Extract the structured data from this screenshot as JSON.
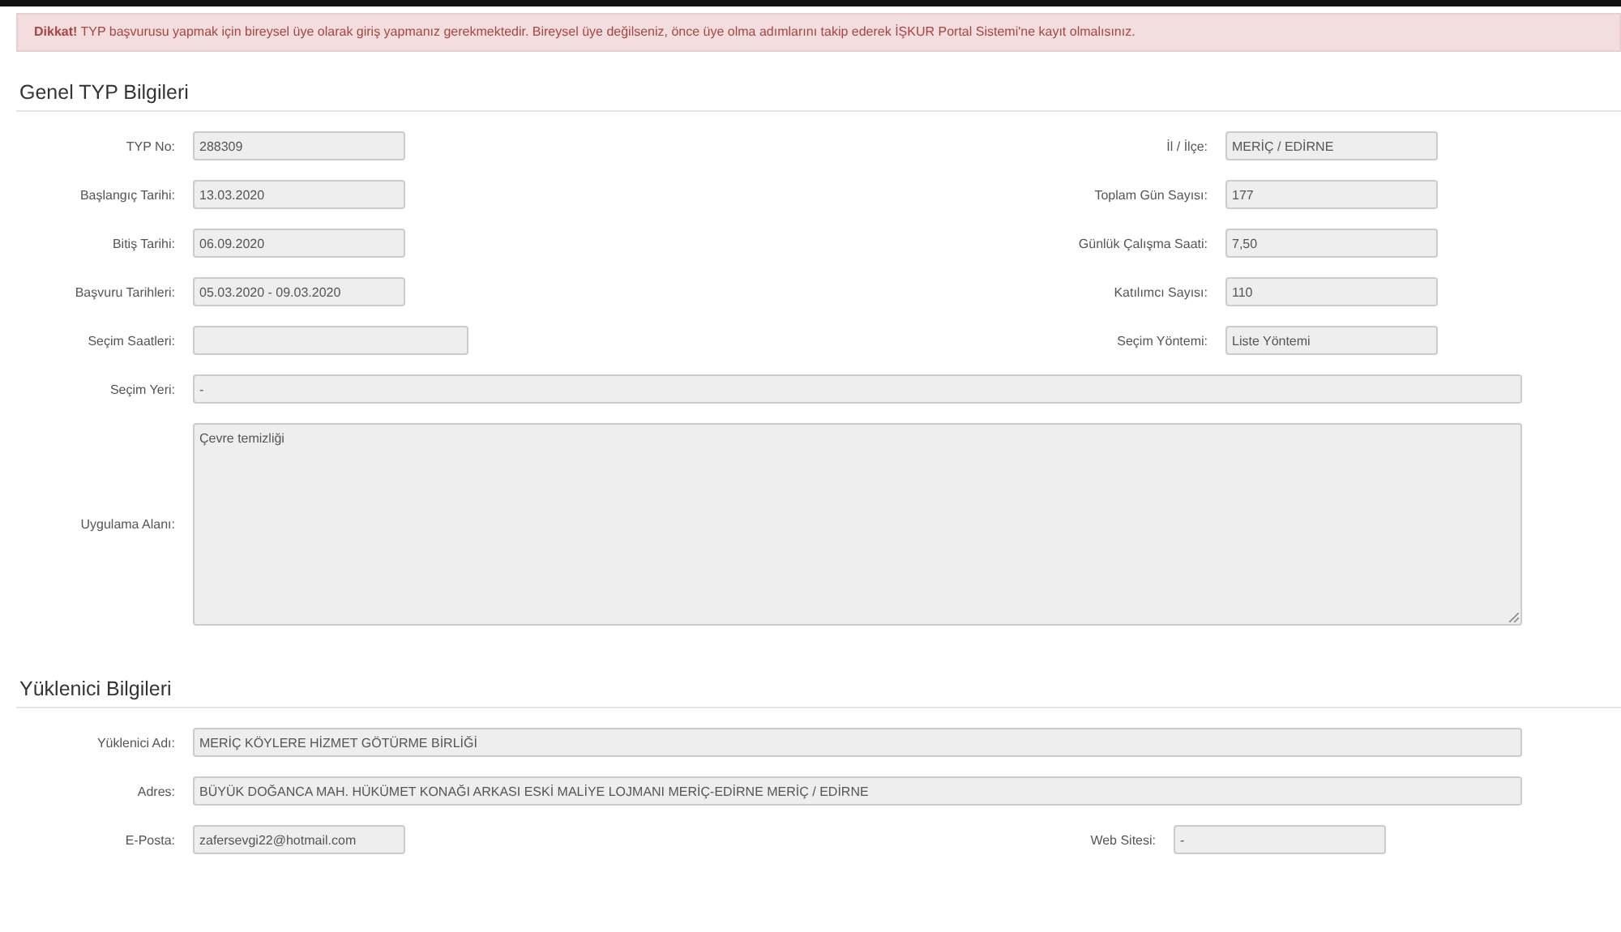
{
  "alert": {
    "text": "**Dikkat!** TYP başvurusu yapmak için bireysel üye olarak giriş yapmanız gerekmektedir. Bireysel üye değilseniz, önce üye olma adımlarını takip ederek İŞKUR Portal Sistemi'ne kayıt olmalısınız."
  },
  "sections": [
    {
      "title": "Genel TYP Bilgileri",
      "rows": [
        {
          "kind": "pair",
          "fields": [
            {
              "label": "TYP No:",
              "value": "288309",
              "kind": "short"
            },
            {
              "label": "İl / İlçe:",
              "value": "MERİÇ / EDİRNE",
              "kind": "short"
            }
          ]
        },
        {
          "kind": "pair",
          "fields": [
            {
              "label": "Başlangıç Tarihi:",
              "value": "13.03.2020",
              "kind": "short"
            },
            {
              "label": "Toplam Gün Sayısı:",
              "value": "177",
              "kind": "short"
            }
          ]
        },
        {
          "kind": "pair",
          "fields": [
            {
              "label": "Bitiş Tarihi:",
              "value": "06.09.2020",
              "kind": "short"
            },
            {
              "label": "Günlük Çalışma Saati:",
              "value": "7,50",
              "kind": "short"
            }
          ]
        },
        {
          "kind": "pair",
          "fields": [
            {
              "label": "Başvuru Tarihleri:",
              "value": "05.03.2020 - 09.03.2020",
              "kind": "short"
            },
            {
              "label": "Katılımcı Sayısı:",
              "value": "110",
              "kind": "short"
            }
          ]
        },
        {
          "kind": "pair",
          "fields": [
            {
              "label": "Seçim Saatleri:",
              "kind": "medium"
            },
            {
              "label": "Seçim Yöntemi:",
              "value": "Liste Yöntemi",
              "kind": "short"
            }
          ]
        },
        {
          "kind": "single",
          "fields": [
            {
              "label": "Seçim Yeri:",
              "value": "-",
              "kind": "full"
            }
          ]
        },
        {
          "kind": "textarea",
          "fields": [
            {
              "label": "Uygulama Alanı:",
              "value": "Çevre temizliği",
              "kind": "full"
            }
          ]
        }
      ]
    },
    {
      "title": "Yüklenici Bilgileri",
      "rows": [
        {
          "kind": "single",
          "fields": [
            {
              "label": "Yüklenici Adı:",
              "value": "MERİÇ KÖYLERE HİZMET GÖTÜRME BİRLİĞİ",
              "kind": "full"
            }
          ]
        },
        {
          "kind": "single",
          "fields": [
            {
              "label": "Adres:",
              "value": "BÜYÜK DOĞANCA MAH. HÜKÜMET KONAĞI ARKASI ESKİ MALİYE LOJMANI MERİÇ-EDİRNE MERİÇ / EDİRNE",
              "kind": "full"
            }
          ]
        },
        {
          "kind": "pair-compact",
          "fields": [
            {
              "label": "E-Posta:",
              "value": "zafersevgi22@hotmail.com",
              "kind": "short"
            },
            {
              "label": "Web Sitesi:",
              "value": "-",
              "kind": "short"
            }
          ]
        }
      ]
    }
  ]
}
